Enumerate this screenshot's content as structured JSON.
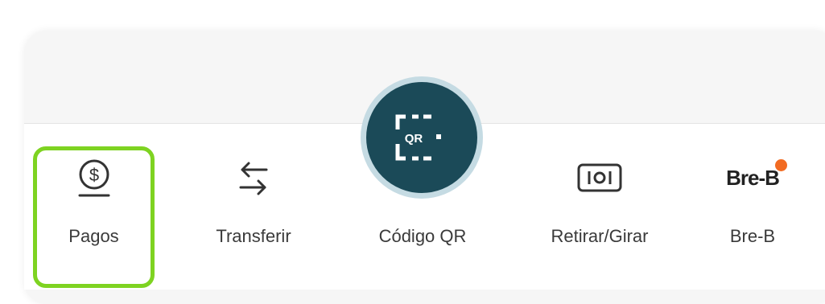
{
  "nav": {
    "items": [
      {
        "label": "Pagos",
        "icon": "dollar-coin-icon"
      },
      {
        "label": "Transferir",
        "icon": "transfer-arrows-icon"
      },
      {
        "label": "Código QR",
        "icon": "qr-code-icon"
      },
      {
        "label": "Retirar/Girar",
        "icon": "withdraw-card-icon"
      },
      {
        "label": "Bre-B",
        "icon": "bre-b-logo",
        "logo_text": "Bre-B"
      }
    ],
    "fab_text": "QR",
    "selected": "Pagos"
  },
  "colors": {
    "fab_bg": "#1b4a58",
    "fab_ring": "#c5dbe3",
    "highlight": "#7ed321",
    "badge": "#f26b22"
  }
}
